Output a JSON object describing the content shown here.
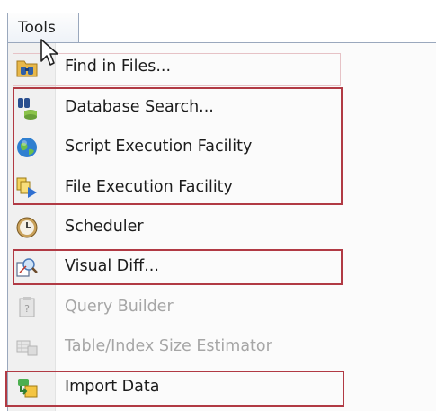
{
  "menubar": {
    "tools_label": "Tools"
  },
  "menu": {
    "items": [
      {
        "label": "Find in Files...",
        "icon": "find-in-files-icon",
        "enabled": true
      },
      {
        "label": "Database Search...",
        "icon": "database-search-icon",
        "enabled": true
      },
      {
        "label": "Script Execution Facility",
        "icon": "globe-icon",
        "enabled": true
      },
      {
        "label": "File Execution Facility",
        "icon": "file-execution-icon",
        "enabled": true
      },
      {
        "label": "Scheduler",
        "icon": "clock-icon",
        "enabled": true
      },
      {
        "label": "Visual Diff...",
        "icon": "visual-diff-icon",
        "enabled": true
      },
      {
        "label": "Query Builder",
        "icon": "query-builder-icon",
        "enabled": false
      },
      {
        "label": "Table/Index Size Estimator",
        "icon": "size-estimator-icon",
        "enabled": false
      },
      {
        "label": "Import Data",
        "icon": "import-data-icon",
        "enabled": true
      }
    ]
  },
  "colors": {
    "highlight_border": "#b13a44",
    "disabled_text": "#a6a6a6",
    "text": "#1c1c1c"
  }
}
